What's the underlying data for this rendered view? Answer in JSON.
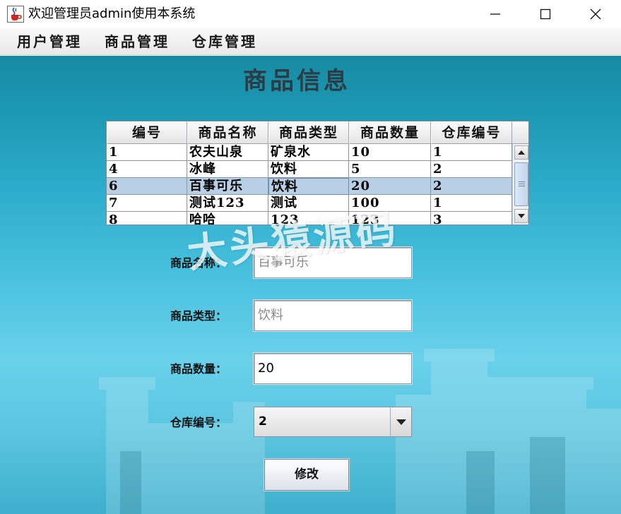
{
  "window": {
    "title": "欢迎管理员admin使用本系统",
    "icon": "java-cup-icon"
  },
  "menu": {
    "items": [
      {
        "label": "用户管理"
      },
      {
        "label": "商品管理"
      },
      {
        "label": "仓库管理"
      }
    ]
  },
  "page": {
    "heading": "商品信息"
  },
  "table": {
    "columns": [
      "编号",
      "商品名称",
      "商品类型",
      "商品数量",
      "仓库编号"
    ],
    "rows": [
      [
        "1",
        "农夫山泉",
        "矿泉水",
        "10",
        "1"
      ],
      [
        "4",
        "冰峰",
        "饮料",
        "5",
        "2"
      ],
      [
        "6",
        "百事可乐",
        "饮料",
        "20",
        "2"
      ],
      [
        "7",
        "测试123",
        "测试",
        "100",
        "1"
      ],
      [
        "8",
        "哈哈",
        "123",
        "123",
        "3"
      ]
    ],
    "selected_row_index": 2
  },
  "form": {
    "name_label": "商品名称：",
    "name_value": "百事可乐",
    "type_label": "商品类型：",
    "type_value": "饮料",
    "quantity_label": "商品数量：",
    "quantity_value": "20",
    "warehouse_label": "仓库编号：",
    "warehouse_value": "2",
    "modify_button": "修改"
  },
  "watermark": "大头猿源码",
  "colors": {
    "selection": "#b8cfe5",
    "background_top": "#178aa3",
    "background_bottom": "#5bc6e0"
  }
}
